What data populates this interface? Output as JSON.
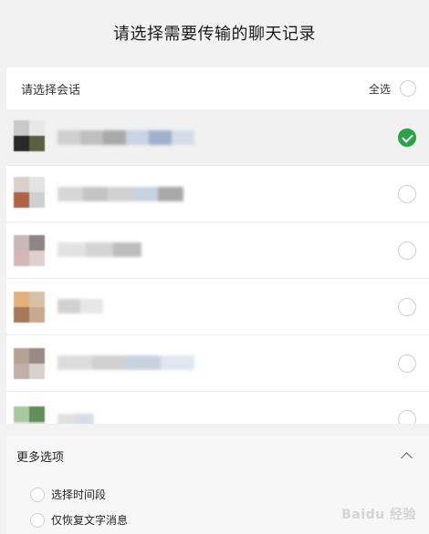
{
  "header": {
    "title": "请选择需要传输的聊天记录"
  },
  "select_bar": {
    "label": "请选择会话",
    "select_all_label": "全选",
    "select_all_checked": false
  },
  "conversations": [
    {
      "selected": true,
      "avatar_colors": [
        "#c9c9c9",
        "#e8e8e8",
        "#2a2a2a",
        "#5a6040"
      ],
      "name_colors": [
        "#cfcfcf",
        "#bfbfbf",
        "#a9a9a9",
        "#c8d3e3",
        "#9fb0cc",
        "#d5dce8"
      ]
    },
    {
      "selected": false,
      "avatar_colors": [
        "#d9d0cc",
        "#e3e3e3",
        "#b06244",
        "#cfcfcf"
      ],
      "name_colors": [
        "#d6d6d6",
        "#c3c3c3",
        "#d1d1d1",
        "#c9d2e0",
        "#a8a8a8"
      ]
    },
    {
      "selected": false,
      "avatar_colors": [
        "#c9b8b8",
        "#8e8686",
        "#d6b7b7",
        "#e0cfcf"
      ],
      "name_colors": [
        "#e2e2e2",
        "#d4d4d4",
        "#bdbdbd"
      ]
    },
    {
      "selected": false,
      "avatar_colors": [
        "#e3b07a",
        "#d8c0a8",
        "#a8785a",
        "#c7a890"
      ],
      "name_colors": [
        "#d1d1d1",
        "#e6e6e6"
      ]
    },
    {
      "selected": false,
      "avatar_colors": [
        "#b6a294",
        "#9a8a84",
        "#c2b0a6",
        "#d8d0cc"
      ],
      "name_colors": [
        "#dcdcdc",
        "#d0d0d0",
        "#c8d2de",
        "#e0e6ee"
      ]
    },
    {
      "selected": false,
      "avatar_colors": [
        "#a8c9a0",
        "#5f8f5a",
        "#e2e2e2",
        "#d0d6cc"
      ],
      "name_colors": [
        "#e0e0e0",
        "#d7dde6"
      ]
    }
  ],
  "more_options": {
    "label": "更多选项",
    "options": [
      {
        "label": "选择时间段"
      },
      {
        "label": "仅恢复文字消息"
      }
    ]
  },
  "watermark": {
    "text": "Baidu 经验"
  }
}
